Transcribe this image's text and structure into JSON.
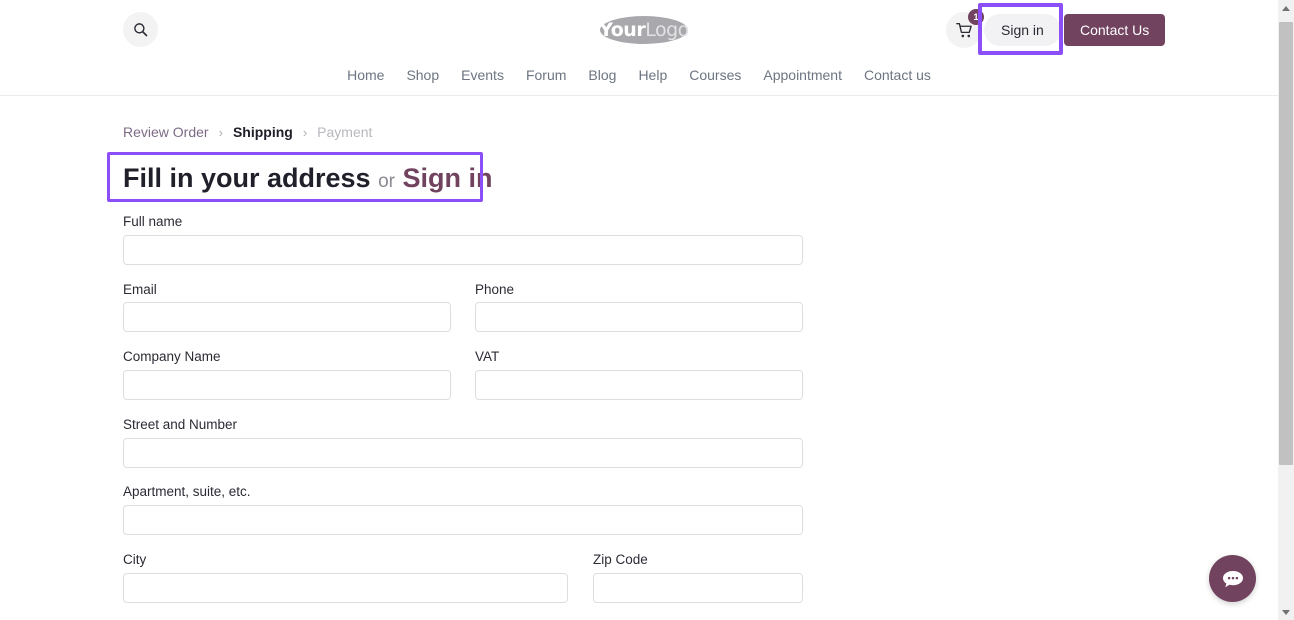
{
  "header": {
    "search_icon": "search-icon",
    "logo": {
      "part1": "Your",
      "part2": "Logo"
    },
    "cart_icon": "shopping-cart-icon",
    "cart_count": "1",
    "signin_label": "Sign in",
    "contact_label": "Contact Us",
    "nav": [
      {
        "label": "Home"
      },
      {
        "label": "Shop"
      },
      {
        "label": "Events"
      },
      {
        "label": "Forum"
      },
      {
        "label": "Blog"
      },
      {
        "label": "Help"
      },
      {
        "label": "Courses"
      },
      {
        "label": "Appointment"
      },
      {
        "label": "Contact us"
      }
    ]
  },
  "breadcrumb": {
    "step1": "Review Order",
    "sep1": "›",
    "step2": "Shipping",
    "sep2": "›",
    "step3": "Payment"
  },
  "heading": {
    "main": "Fill in your address",
    "or": "or",
    "link": "Sign in"
  },
  "form": {
    "fields": [
      {
        "label": "Full name",
        "value": "",
        "placeholder": ""
      },
      {
        "label": "Email",
        "value": "",
        "placeholder": ""
      },
      {
        "label": "Phone",
        "value": "",
        "placeholder": ""
      },
      {
        "label": "Company Name",
        "value": "",
        "placeholder": ""
      },
      {
        "label": "VAT",
        "value": "",
        "placeholder": ""
      },
      {
        "label": "Street and Number",
        "value": "",
        "placeholder": ""
      },
      {
        "label": "Apartment, suite, etc.",
        "value": "",
        "placeholder": ""
      },
      {
        "label": "City",
        "value": "",
        "placeholder": ""
      },
      {
        "label": "Zip Code",
        "value": "",
        "placeholder": ""
      }
    ]
  },
  "chat": {
    "icon": "chat-bubble-icon"
  },
  "colors": {
    "accent_highlight": "#8c4ff7",
    "brand": "#71435f",
    "text": "#2b2b35",
    "muted": "#6c7581",
    "border": "#dedde1"
  }
}
